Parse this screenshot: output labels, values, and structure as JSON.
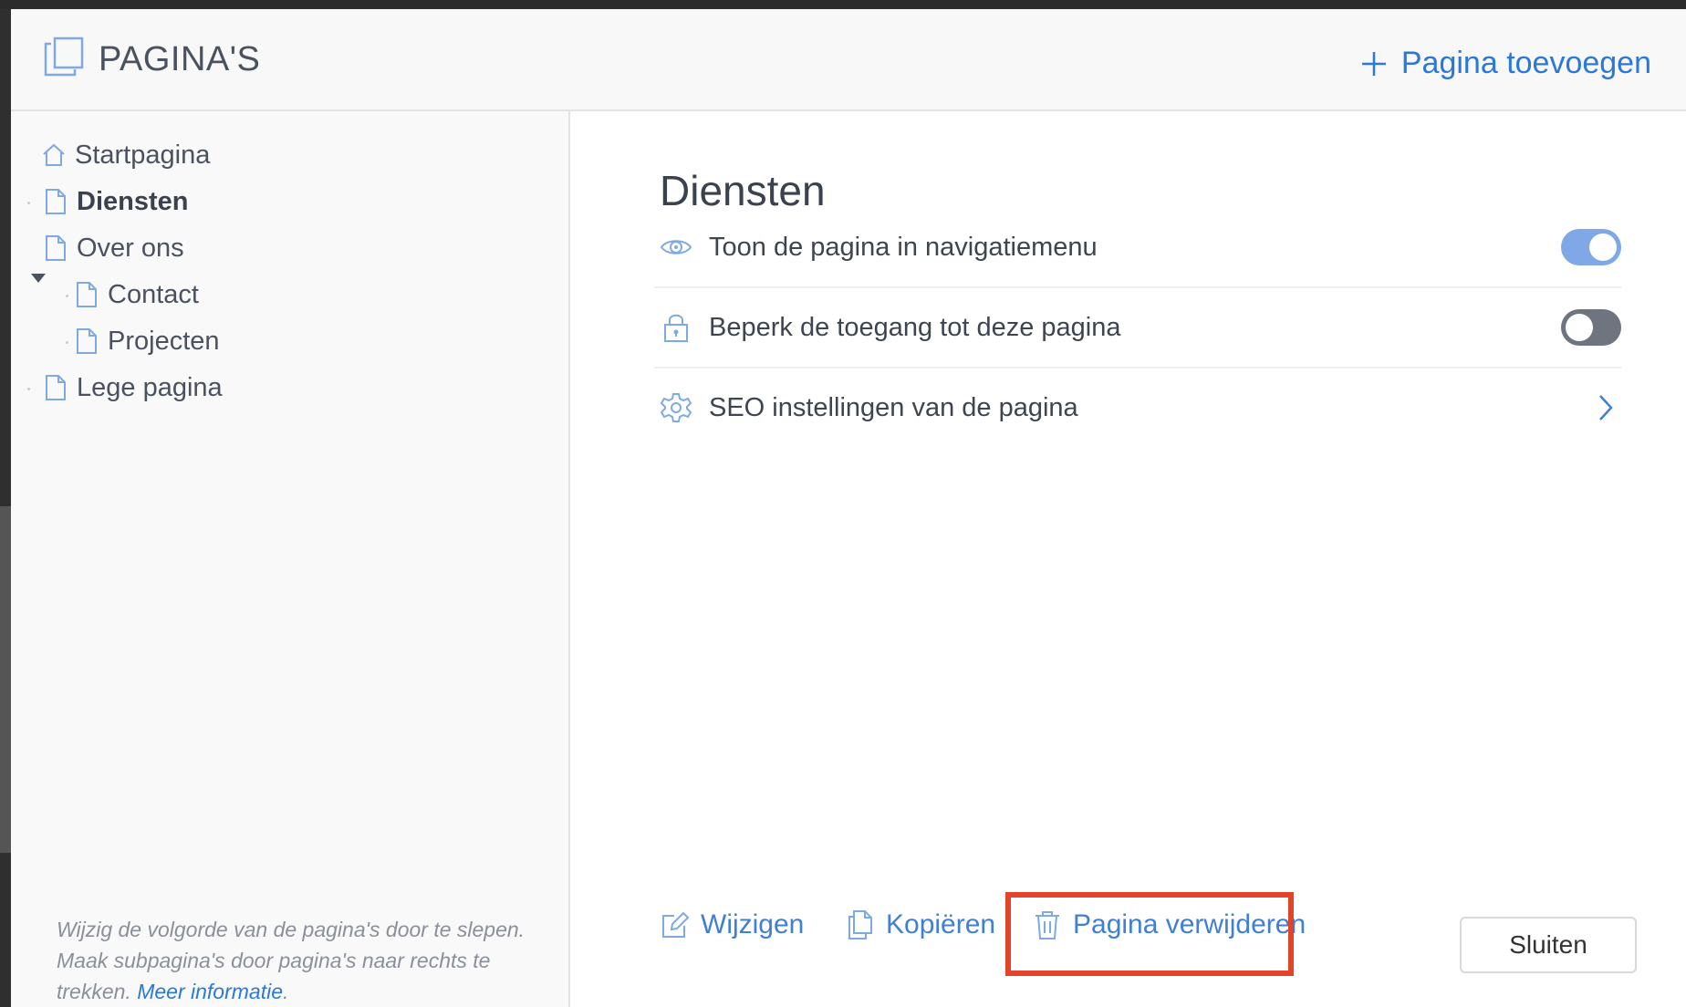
{
  "header": {
    "title": "PAGINA'S",
    "add_page_label": "Pagina toevoegen"
  },
  "sidebar": {
    "items": [
      {
        "label": "Startpagina",
        "icon": "home-icon"
      },
      {
        "label": "Diensten",
        "icon": "page-icon",
        "active": true
      },
      {
        "label": "Over ons",
        "icon": "page-icon",
        "expanded": true
      },
      {
        "label": "Contact",
        "icon": "page-icon",
        "child": true
      },
      {
        "label": "Projecten",
        "icon": "page-icon",
        "child": true
      },
      {
        "label": "Lege pagina",
        "icon": "page-icon"
      }
    ],
    "help_text": "Wijzig de volgorde van de pagina's door te slepen. Maak subpagina's door pagina's naar rechts te trekken.",
    "help_link": "Meer informatie",
    "help_period": "."
  },
  "main": {
    "heading": "Diensten",
    "settings": [
      {
        "label": "Toon de pagina in navigatiemenu",
        "icon": "eye-icon",
        "control": "toggle",
        "on": true
      },
      {
        "label": "Beperk de toegang tot deze pagina",
        "icon": "lock-icon",
        "control": "toggle",
        "on": false
      },
      {
        "label": "SEO instellingen van de pagina",
        "icon": "gear-icon",
        "control": "chevron"
      }
    ]
  },
  "footer": {
    "edit_label": "Wijzigen",
    "copy_label": "Kopiëren",
    "delete_label": "Pagina verwijderen",
    "close_label": "Sluiten"
  },
  "colors": {
    "accent": "#2b78d8",
    "toggle_on": "#7fa9e6",
    "toggle_off": "#6e757e",
    "highlight": "#e2442a"
  }
}
